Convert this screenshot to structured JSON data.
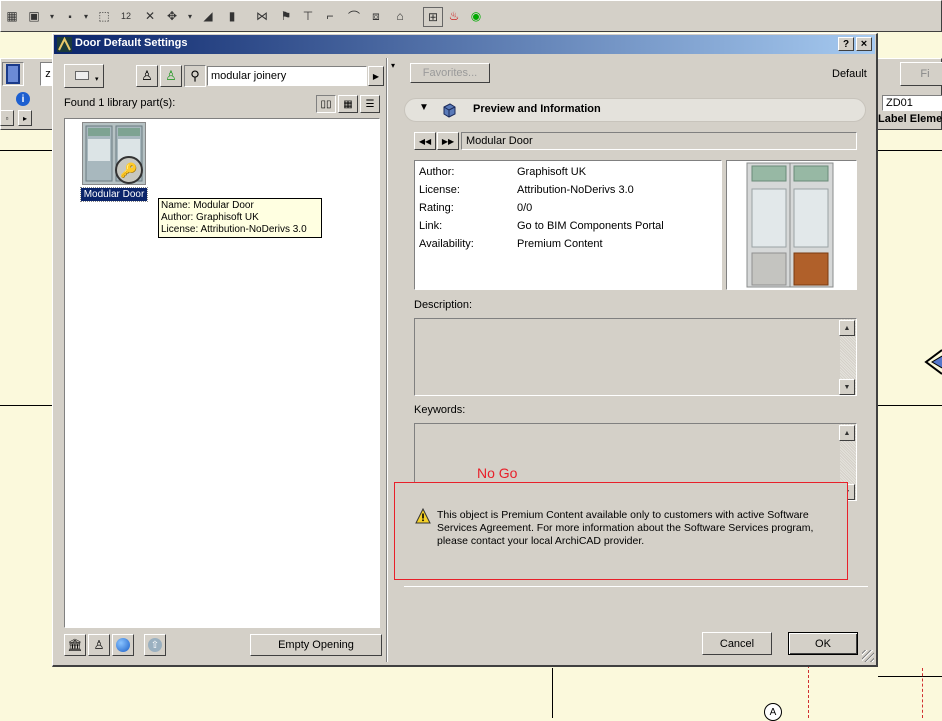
{
  "dialog": {
    "title": "Door Default Settings",
    "help_label": "?",
    "close_label": "×"
  },
  "library": {
    "search_value": "modular joinery",
    "found_text": "Found 1 library part(s):",
    "item_label": "Modular Door",
    "tooltip": {
      "name": "Name: Modular Door",
      "author": "Author: Graphisoft UK",
      "license": "License: Attribution-NoDerivs 3.0"
    },
    "empty_opening_label": "Empty Opening"
  },
  "right": {
    "favorites_label": "Favorites...",
    "default_label": "Default",
    "section_title": "Preview and Information",
    "item_name": "Modular Door",
    "info": [
      {
        "key": "Author:",
        "value": "Graphisoft UK"
      },
      {
        "key": "License:",
        "value": "Attribution-NoDerivs 3.0"
      },
      {
        "key": "Rating:",
        "value": "0/0"
      },
      {
        "key": "Link:",
        "value": "Go to BIM Components Portal"
      },
      {
        "key": "Availability:",
        "value": "Premium Content"
      }
    ],
    "description_label": "Description:",
    "keywords_label": "Keywords:",
    "warning_lines": [
      "This object is Premium Content available only to customers with active Software",
      "Services Agreement. For more information about the Software Services program,",
      "please contact your local ArchiCAD provider."
    ],
    "annotation": "No Go",
    "cancel_label": "Cancel",
    "ok_label": "OK"
  },
  "background": {
    "zone_field": "ZD01",
    "label_text": "Label Elemen",
    "fi_label": "Fi",
    "z_label": "z",
    "grid_marker": "A"
  },
  "colors": {
    "titlebar_start": "#0a246a",
    "titlebar_end": "#a6caf0",
    "annotation_red": "#e8202a",
    "selection": "#0a246a",
    "tooltip_bg": "#ffffe1"
  }
}
